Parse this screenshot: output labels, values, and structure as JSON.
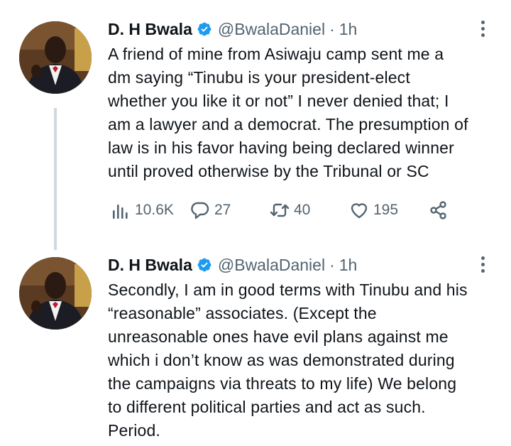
{
  "tweets": [
    {
      "author": {
        "display_name": "D. H Bwala",
        "handle": "@BwalaDaniel"
      },
      "separator": "·",
      "time": "1h",
      "lines": [
        "A friend of mine from Asiwaju camp sent me a",
        "dm saying “Tinubu is your president-elect",
        "whether you like it or not” I never denied that; I",
        "am a lawyer and a democrat. The presumption of",
        "law is in his favor having being declared winner",
        "until proved otherwise by the Tribunal or SC"
      ],
      "stats": {
        "views": "10.6K",
        "replies": "27",
        "retweets": "40",
        "likes": "195"
      }
    },
    {
      "author": {
        "display_name": "D. H Bwala",
        "handle": "@BwalaDaniel"
      },
      "separator": "·",
      "time": "1h",
      "lines": [
        "Secondly, I am in good terms with Tinubu and his",
        "“reasonable” associates. (Except the",
        "unreasonable ones have evil plans against me",
        "which i don’t know as was demonstrated during",
        "the campaigns via threats to my life) We belong",
        "to different political parties and act as such.",
        "Period."
      ]
    }
  ],
  "icons": {
    "verified": "verified-badge-icon",
    "more": "more-options-icon",
    "views": "views-chart-icon",
    "reply": "reply-bubble-icon",
    "retweet": "retweet-arrows-icon",
    "like": "heart-icon",
    "share": "share-nodes-icon"
  },
  "colors": {
    "verified_blue": "#1d9bf0",
    "text_primary": "#0f1419",
    "text_secondary": "#536471",
    "thread_line": "#cfd9de"
  }
}
